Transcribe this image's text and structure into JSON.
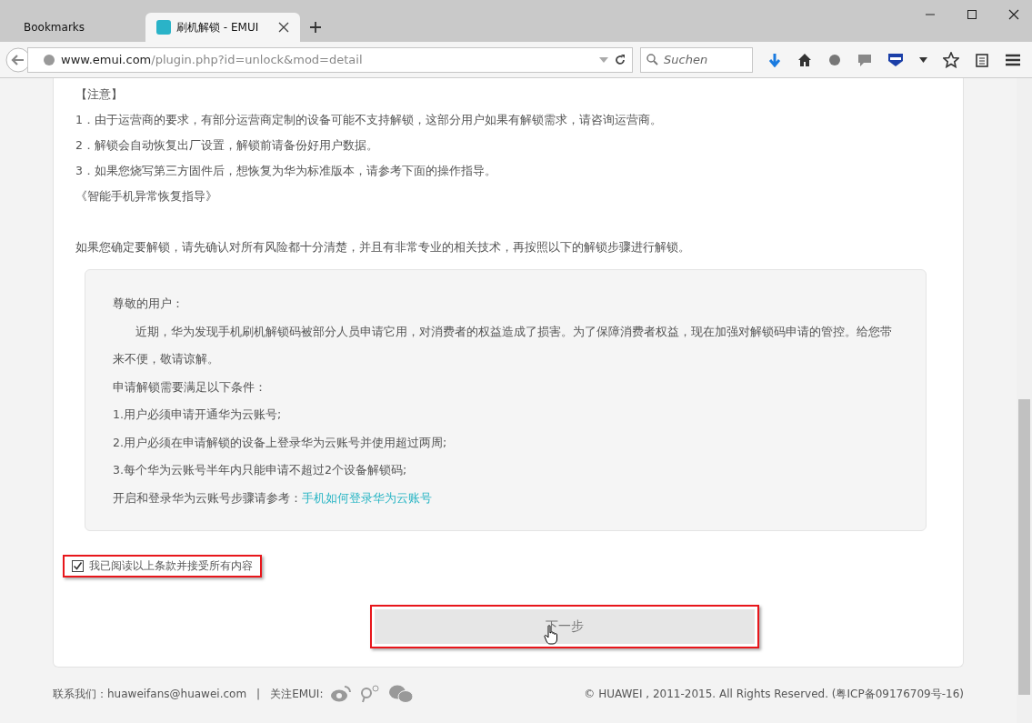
{
  "tabs": [
    {
      "label": "Bookmarks",
      "selected": false
    },
    {
      "label": "刷机解锁 - EMUI",
      "selected": true
    }
  ],
  "address": {
    "host": "www.emui.com",
    "path": "/plugin.php?id=unlock&mod=detail"
  },
  "search": {
    "placeholder": "Suchen"
  },
  "notice": {
    "heading": "【注意】",
    "items": [
      "1．由于运营商的要求，有部分运营商定制的设备可能不支持解锁，这部分用户如果有解锁需求，请咨询运营商。",
      "2．解锁会自动恢复出厂设置，解锁前请备份好用户数据。",
      "3．如果您烧写第三方固件后，想恢复为华为标准版本，请参考下面的操作指导。"
    ],
    "guide_link": "《智能手机异常恢复指导》",
    "warning": "如果您确定要解锁，请先确认对所有风险都十分清楚，并且有非常专业的相关技术，再按照以下的解锁步骤进行解锁。"
  },
  "letter": {
    "greeting": "尊敬的用户：",
    "body": "近期，华为发现手机刷机解锁码被部分人员申请它用，对消费者的权益造成了损害。为了保障消费者权益，现在加强对解锁码申请的管控。给您带来不便，敬请谅解。",
    "conditions_title": "申请解锁需要满足以下条件：",
    "conditions": [
      "1.用户必须申请开通华为云账号;",
      "2.用户必须在申请解锁的设备上登录华为云账号并使用超过两周;",
      "3.每个华为云账号半年内只能申请不超过2个设备解锁码;"
    ],
    "reference_label": "开启和登录华为云账号步骤请参考：",
    "reference_link": "手机如何登录华为云账号"
  },
  "agree": {
    "label": "我已阅读以上条款并接受所有内容",
    "checked": true
  },
  "next_button": "下一步",
  "footer": {
    "contact": "联系我们：huaweifans@huawei.com",
    "separator": "|",
    "follow": "关注EMUI:",
    "copyright": "© HUAWEI , 2011-2015. All Rights Reserved. (粤ICP备09176709号-16)"
  }
}
